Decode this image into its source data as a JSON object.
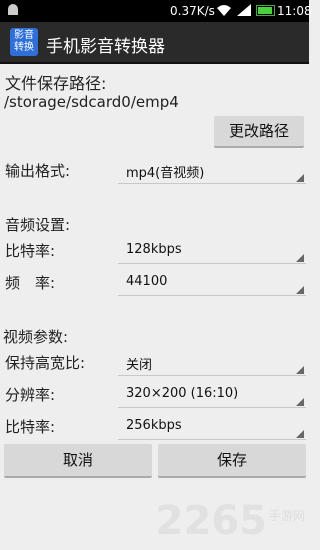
{
  "statusbar": {
    "speed": "0.37K/s",
    "time": "11:08"
  },
  "app": {
    "title": "手机影音转换器",
    "logo_text": "影音转换"
  },
  "save_path": {
    "label": "文件保存路径:",
    "value": "/storage/sdcard0/emp4",
    "change_button": "更改路径"
  },
  "output": {
    "label": "输出格式:",
    "value": "mp4(音视频)"
  },
  "audio": {
    "section": "音频设置:",
    "bitrate_label": "比特率:",
    "bitrate_value": "128kbps",
    "freq_label": "频　率:",
    "freq_value": "44100"
  },
  "video": {
    "section": "视频参数:",
    "aspect_label": "保持高宽比:",
    "aspect_value": "关闭",
    "res_label": "分辨率:",
    "res_value": "320×200 (16:10)",
    "bitrate_label": "比特率:",
    "bitrate_value": "256kbps"
  },
  "buttons": {
    "cancel": "取消",
    "save": "保存"
  },
  "watermark": {
    "main": "2265",
    "sub": "手游网"
  }
}
